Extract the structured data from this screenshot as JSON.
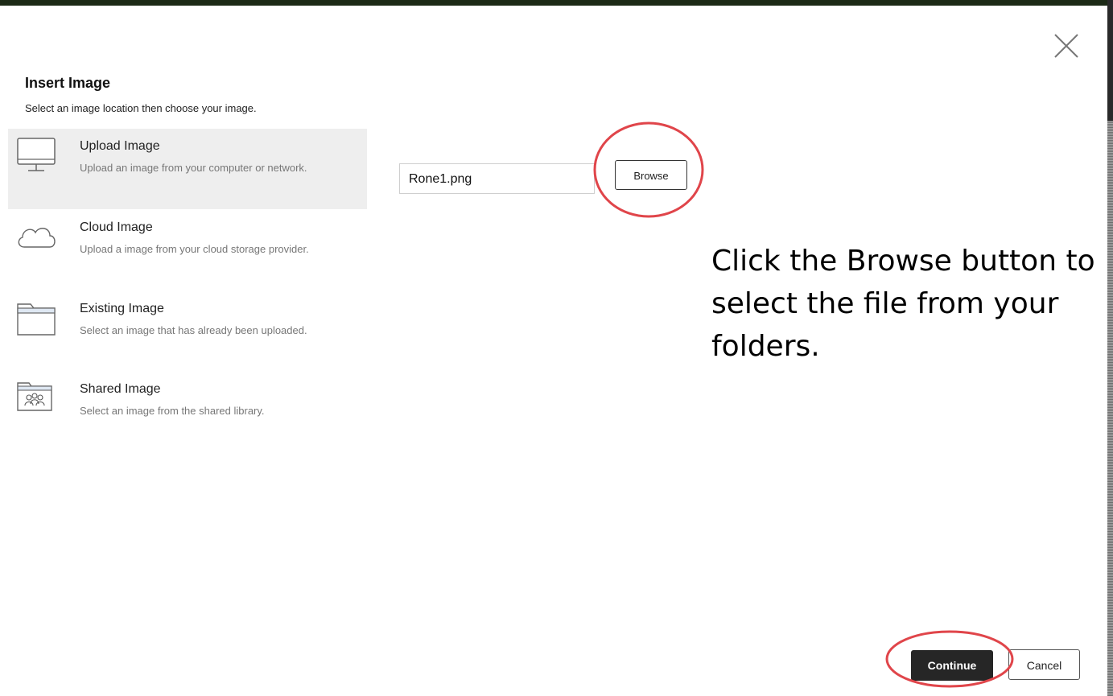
{
  "dialog": {
    "title": "Insert Image",
    "subtitle": "Select an image location then choose your image.",
    "close_icon": "close-icon"
  },
  "options": [
    {
      "name": "Upload Image",
      "description": "Upload an image from your computer or network.",
      "icon": "monitor-icon",
      "selected": true
    },
    {
      "name": "Cloud Image",
      "description": "Upload a image from your cloud storage provider.",
      "icon": "cloud-icon",
      "selected": false
    },
    {
      "name": "Existing Image",
      "description": "Select an image that has already been uploaded.",
      "icon": "folder-icon",
      "selected": false
    },
    {
      "name": "Shared Image",
      "description": "Select an image from the shared library.",
      "icon": "shared-folder-icon",
      "selected": false
    }
  ],
  "upload": {
    "file_value": "Rone1.png",
    "browse_label": "Browse"
  },
  "annotation": {
    "instruction": "Click the Browse button to select the file from your folders.",
    "highlight_color": "#e0454a"
  },
  "footer": {
    "continue_label": "Continue",
    "cancel_label": "Cancel"
  },
  "colors": {
    "selected_bg": "#eeeeee",
    "primary_button": "#262626"
  }
}
